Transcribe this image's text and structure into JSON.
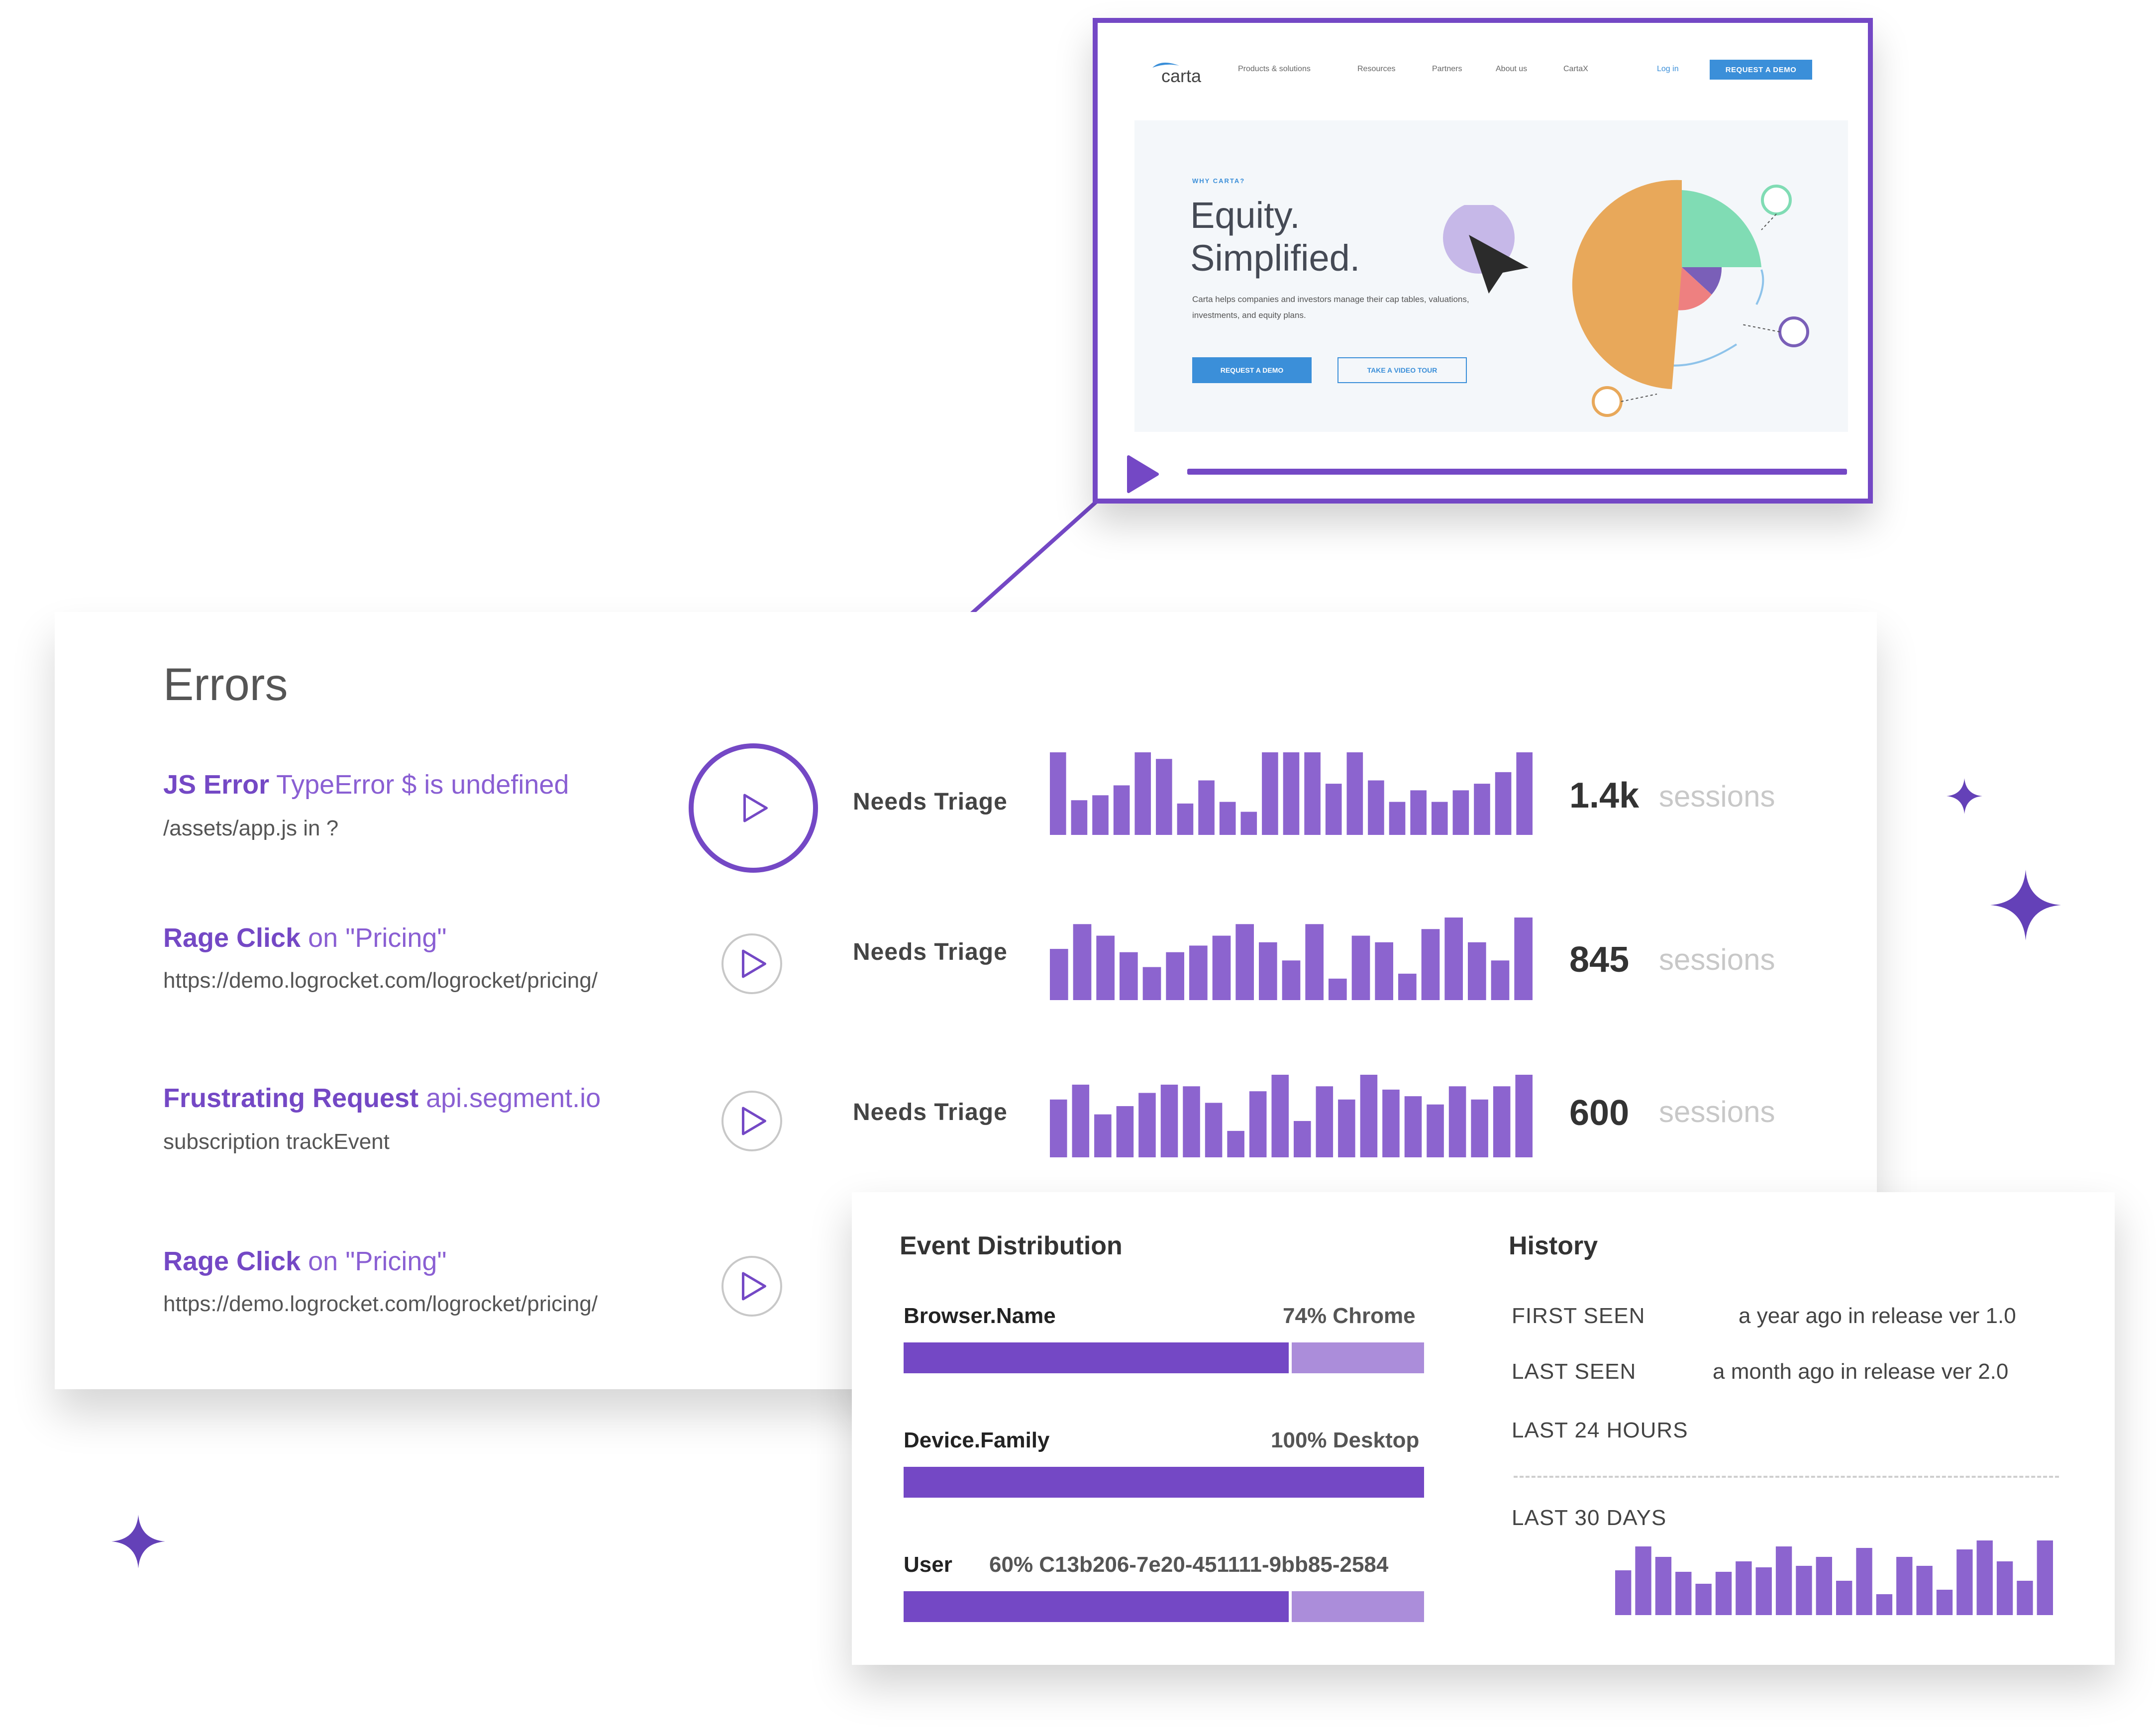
{
  "preview": {
    "logo": "carta",
    "nav": [
      "Products & solutions",
      "Resources",
      "Partners",
      "About us",
      "CartaX"
    ],
    "login": "Log in",
    "cta": "REQUEST A DEMO",
    "eyebrow": "WHY CARTA?",
    "headline_1": "Equity.",
    "headline_2": "Simplified.",
    "body": "Carta helps companies and investors manage their cap tables, valuations, investments, and equity plans.",
    "primary_button": "REQUEST A DEMO",
    "secondary_button": "TAKE A VIDEO TOUR",
    "accent": "#7448c5"
  },
  "errors": {
    "title": "Errors",
    "rows": [
      {
        "type": "JS Error",
        "detail": "TypeError $ is undefined",
        "sub": "/assets/app.js in ?",
        "status": "Needs Triage",
        "count": "1.4k",
        "unit": "sessions",
        "bars": [
          100,
          42,
          48,
          60,
          100,
          92,
          38,
          66,
          40,
          28,
          100,
          100,
          100,
          62,
          100,
          66,
          40,
          54,
          40,
          54,
          62,
          76,
          100
        ]
      },
      {
        "type": "Rage Click",
        "detail": "on \"Pricing\"",
        "sub": "https://demo.logrocket.com/logrocket/pricing/",
        "status": "Needs Triage",
        "count": "845",
        "unit": "sessions",
        "bars": [
          62,
          92,
          78,
          58,
          40,
          58,
          66,
          78,
          92,
          70,
          48,
          92,
          26,
          78,
          70,
          32,
          86,
          100,
          70,
          48,
          100
        ]
      },
      {
        "type": "Frustrating Request",
        "detail": "api.segment.io",
        "sub": "subscription trackEvent",
        "status": "Needs Triage",
        "count": "600",
        "unit": "sessions",
        "bars": [
          70,
          88,
          52,
          62,
          78,
          88,
          86,
          66,
          32,
          80,
          100,
          44,
          86,
          70,
          100,
          82,
          74,
          64,
          86,
          70,
          86,
          100
        ]
      },
      {
        "type": "Rage Click",
        "detail": "on \"Pricing\"",
        "sub": "https://demo.logrocket.com/logrocket/pricing/"
      }
    ]
  },
  "distribution": {
    "title": "Event Distribution",
    "items": [
      {
        "label": "Browser.Name",
        "value": "74% Chrome",
        "fraction": 0.74
      },
      {
        "label": "Device.Family",
        "value": "100% Desktop",
        "fraction": 1.0
      },
      {
        "label": "User",
        "value": "60% C13b206-7e20-451111-9bb85-2584",
        "fraction": 0.74
      }
    ]
  },
  "history": {
    "title": "History",
    "first_seen_label": "FIRST SEEN",
    "first_seen_value": "a year ago in release ver 1.0",
    "last_seen_label": "LAST SEEN",
    "last_seen_value": "a month ago in release ver 2.0",
    "last_24_label": "LAST 24 HOURS",
    "last_30_label": "LAST 30 DAYS",
    "bars": [
      60,
      92,
      78,
      58,
      42,
      58,
      72,
      64,
      92,
      66,
      78,
      46,
      90,
      28,
      78,
      66,
      34,
      88,
      100,
      72,
      46,
      100
    ]
  }
}
